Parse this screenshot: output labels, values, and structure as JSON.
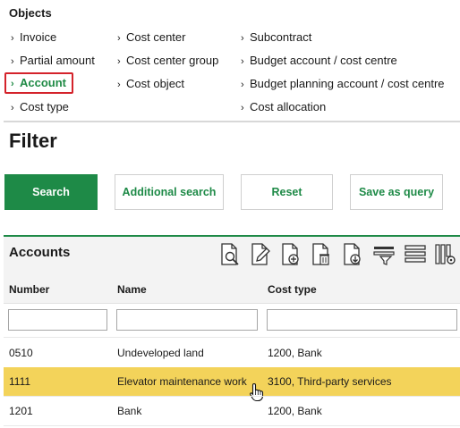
{
  "objects": {
    "title": "Objects",
    "links": [
      {
        "label": "Invoice",
        "active": false
      },
      {
        "label": "Partial amount",
        "active": false
      },
      {
        "label": "Account",
        "active": true
      },
      {
        "label": "Cost type",
        "active": false
      },
      {
        "label": "Cost center",
        "active": false
      },
      {
        "label": "Cost center group",
        "active": false
      },
      {
        "label": "Cost object",
        "active": false
      },
      {
        "label": "Subcontract",
        "active": false
      },
      {
        "label": "Budget account / cost centre",
        "active": false
      },
      {
        "label": "Budget planning account / cost centre",
        "active": false
      },
      {
        "label": "Cost allocation",
        "active": false
      }
    ]
  },
  "filter": {
    "title": "Filter",
    "buttons": {
      "search": "Search",
      "additional_search": "Additional search",
      "reset": "Reset",
      "save_as_query": "Save as query"
    }
  },
  "accounts": {
    "title": "Accounts",
    "toolbar_icons": [
      "preview-icon",
      "edit-icon",
      "new-icon",
      "delete-icon",
      "export-icon",
      "filter-rows-icon",
      "row-layout-icon",
      "column-settings-icon"
    ],
    "columns": {
      "number": "Number",
      "name": "Name",
      "cost_type": "Cost type"
    },
    "filters": {
      "number": "",
      "name": "",
      "cost_type": ""
    },
    "rows": [
      {
        "number": "0510",
        "name": "Undeveloped land",
        "cost_type": "1200, Bank",
        "selected": false
      },
      {
        "number": "1111",
        "name": "Elevator maintenance work",
        "cost_type": "3100, Third-party services",
        "selected": true
      },
      {
        "number": "1201",
        "name": "Bank",
        "cost_type": "1200, Bank",
        "selected": false
      }
    ]
  },
  "colors": {
    "primary_green": "#1e8a47",
    "active_border_red": "#d4232b",
    "selected_row": "#f3d35a"
  }
}
